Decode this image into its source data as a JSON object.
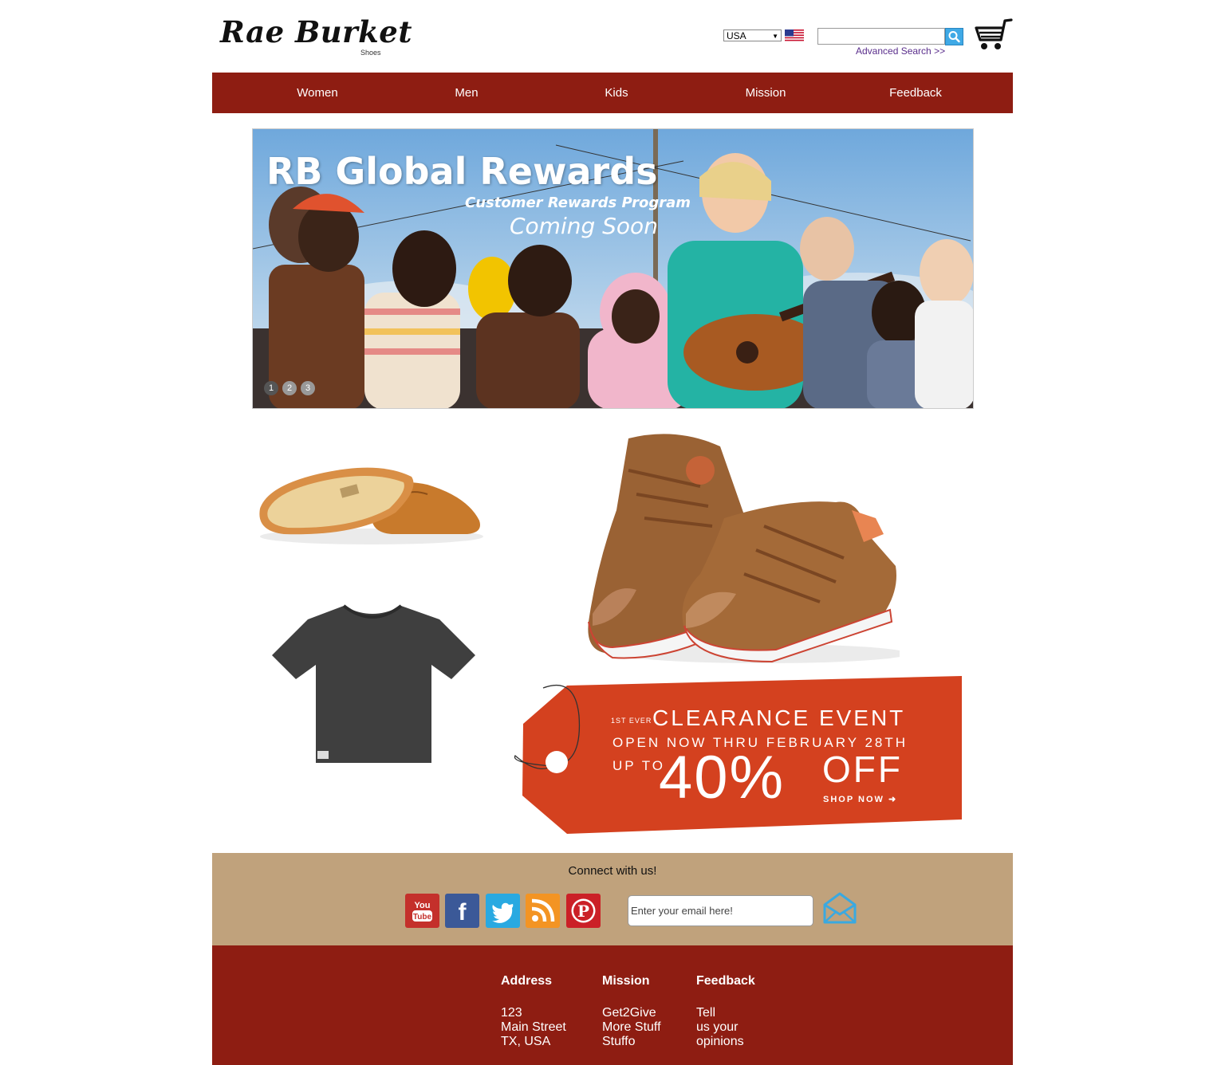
{
  "brand": {
    "name": "Rae Burket",
    "sub": "Shoes"
  },
  "header": {
    "country_selected": "USA",
    "search_placeholder": "",
    "advanced_search": "Advanced Search >>"
  },
  "nav": {
    "items": [
      "Women",
      "Men",
      "Kids",
      "Mission",
      "Feedback"
    ]
  },
  "hero": {
    "title": "RB Global Rewards",
    "subtitle": "Customer Rewards Program",
    "tagline": "Coming Soon",
    "dots": [
      "1",
      "2",
      "3"
    ]
  },
  "promo": {
    "prefix": "1ST EVER",
    "headline": "CLEARANCE EVENT",
    "dates": "OPEN NOW THRU FEBRUARY 28TH",
    "up_to": "UP TO",
    "percent": "40%",
    "off": "OFF",
    "cta": "SHOP NOW"
  },
  "connect": {
    "title": "Connect with us!",
    "social": [
      {
        "icon": "youtube-icon",
        "label": "You Tube",
        "color": "#c4302b"
      },
      {
        "icon": "facebook-icon",
        "label": "f",
        "color": "#3b5998"
      },
      {
        "icon": "twitter-icon",
        "label": "",
        "color": "#29a9e1"
      },
      {
        "icon": "rss-icon",
        "label": "",
        "color": "#f39423"
      },
      {
        "icon": "pinterest-icon",
        "label": "P",
        "color": "#cb2027"
      }
    ],
    "email_placeholder": "Enter your email here!"
  },
  "footer": {
    "columns": [
      {
        "heading": "Address",
        "lines": [
          "123",
          "Main Street",
          "TX, USA"
        ]
      },
      {
        "heading": "Mission",
        "lines": [
          "Get2Give",
          "More Stuff",
          "Stuffo"
        ]
      },
      {
        "heading": "Feedback",
        "lines": [
          "Tell",
          "us your",
          "opinions"
        ]
      }
    ]
  },
  "colors": {
    "nav": "#8e1d12",
    "connect": "#c0a27c",
    "promo": "#d4411f",
    "link": "#5a2e8c"
  }
}
